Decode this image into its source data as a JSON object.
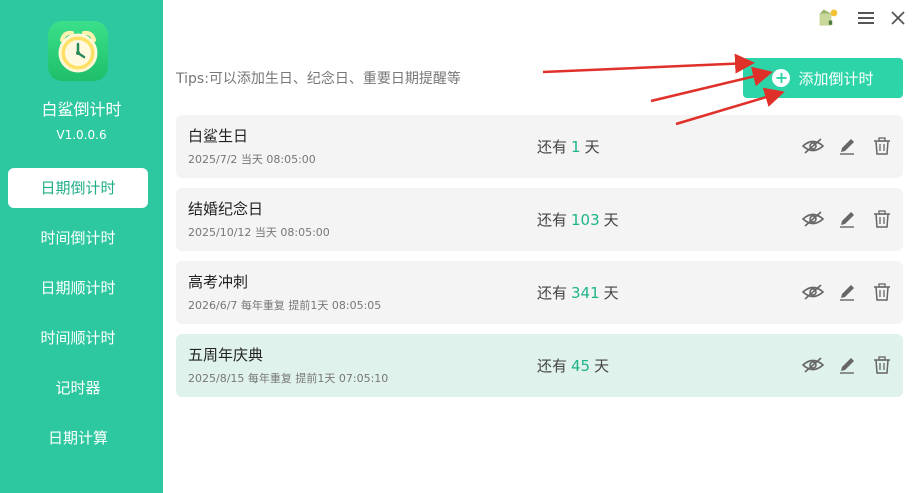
{
  "app": {
    "name": "白鲨倒计时",
    "version": "V1.0.0.6"
  },
  "sidebar": {
    "items": [
      {
        "label": "日期倒计时",
        "active": true
      },
      {
        "label": "时间倒计时",
        "active": false
      },
      {
        "label": "日期顺计时",
        "active": false
      },
      {
        "label": "时间顺计时",
        "active": false
      },
      {
        "label": "记时器",
        "active": false
      },
      {
        "label": "日期计算",
        "active": false
      }
    ]
  },
  "header": {
    "tips": "Tips:可以添加生日、纪念日、重要日期提醒等",
    "add_button": "添加倒计时"
  },
  "countdowns": [
    {
      "title": "白鲨生日",
      "subtitle": "2025/7/2 当天 08:05:00",
      "prefix": "还有",
      "days": "1",
      "unit": "天",
      "highlight": false
    },
    {
      "title": "结婚纪念日",
      "subtitle": "2025/10/12 当天 08:05:00",
      "prefix": "还有",
      "days": "103",
      "unit": "天",
      "highlight": false
    },
    {
      "title": "高考冲刺",
      "subtitle": "2026/6/7 每年重复 提前1天 08:05:05",
      "prefix": "还有",
      "days": "341",
      "unit": "天",
      "highlight": false
    },
    {
      "title": "五周年庆典",
      "subtitle": "2025/8/15 每年重复 提前1天 07:05:10",
      "prefix": "还有",
      "days": "45",
      "unit": "天",
      "highlight": true
    }
  ],
  "colors": {
    "sidebar": "#2dc8a0",
    "accent": "#2dd4a8",
    "number": "#1fb389",
    "annotation_arrow": "#e0302a"
  },
  "icons": {
    "logo": "alarm-clock-icon",
    "skin": "skin-icon",
    "menu": "menu-icon",
    "close": "close-icon",
    "hide": "eye-slash-icon",
    "edit": "pencil-icon",
    "delete": "trash-icon"
  }
}
